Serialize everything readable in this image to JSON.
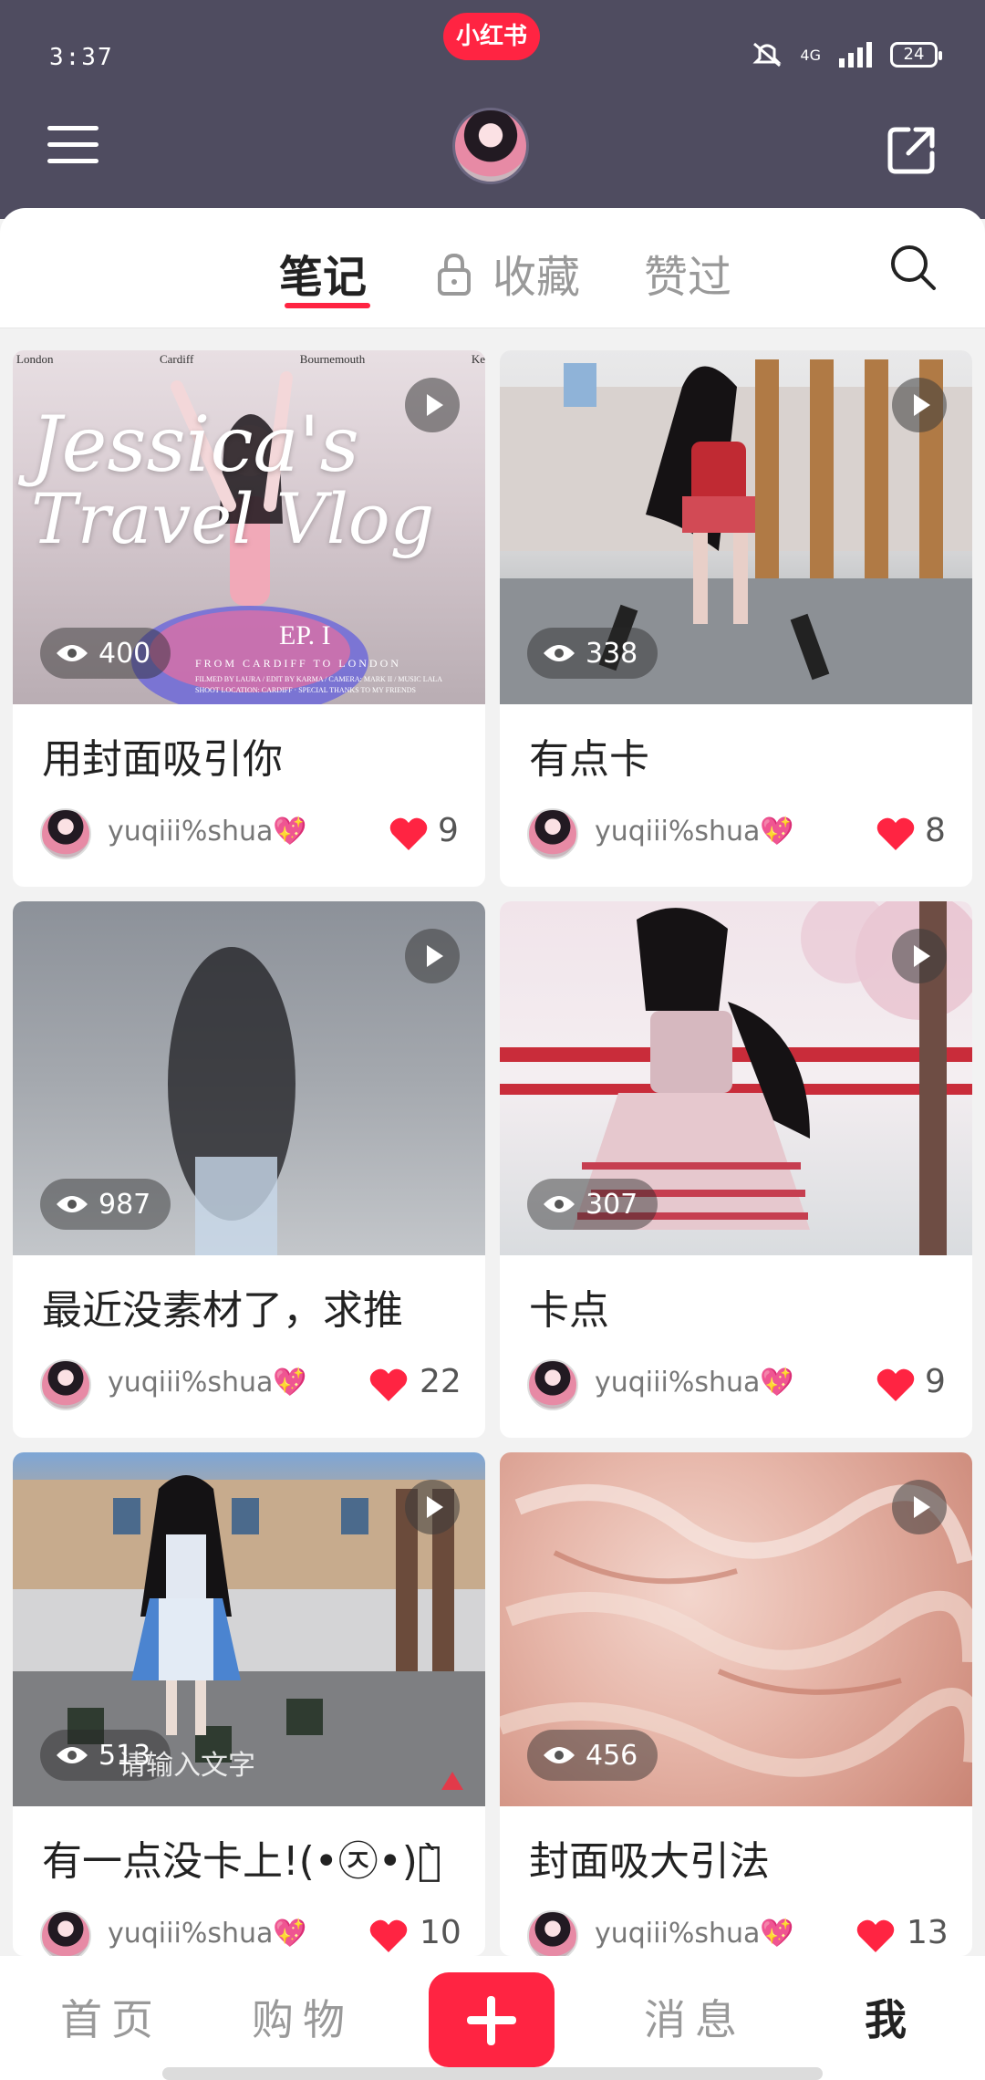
{
  "status": {
    "time": "3:37",
    "network": "4G",
    "battery": "24"
  },
  "brand": {
    "label": "小红书"
  },
  "tabs": [
    {
      "label": "笔记"
    },
    {
      "label": "收藏"
    },
    {
      "label": "赞过"
    }
  ],
  "notes": [
    {
      "title": "用封面吸引你",
      "views": "400",
      "author": "yuqiii%shua💖",
      "likes": "9"
    },
    {
      "title": "有点卡",
      "views": "338",
      "author": "yuqiii%shua💖",
      "likes": "8"
    },
    {
      "title": "最近没素材了，求推",
      "views": "987",
      "author": "yuqiii%shua💖",
      "likes": "22"
    },
    {
      "title": "卡点",
      "views": "307",
      "author": "yuqiii%shua💖",
      "likes": "9"
    },
    {
      "title": "有一点没卡上!(•㉨•)ง̀",
      "views": "513",
      "overlay_text": "请输入文字",
      "author": "yuqiii%shua💖",
      "likes": "10"
    },
    {
      "title": "封面吸大引法",
      "views": "456",
      "author": "yuqiii%shua💖",
      "likes": "13"
    }
  ],
  "cover_text": {
    "cities": [
      "London",
      "Cardiff",
      "Bournemouth",
      "Ke"
    ],
    "title_line1": "Jessica's",
    "title_line2": "Travel Vlog",
    "episode": "EP. I",
    "subtitle": "FROM CARDIFF TO LONDON",
    "credits1": "FILMED BY LAURA / EDIT BY KARMA / CAMERA: MARK II / MUSIC LALA",
    "credits2": "SHOOT LOCATION: CARDIFF · SPECIAL THANKS TO MY FRIENDS"
  },
  "bottom_nav": [
    {
      "label": "首页"
    },
    {
      "label": "购物"
    },
    {
      "label": "消息"
    },
    {
      "label": "我"
    }
  ],
  "colors": {
    "accent": "#ff2442",
    "header_bg": "#4f4c60"
  }
}
